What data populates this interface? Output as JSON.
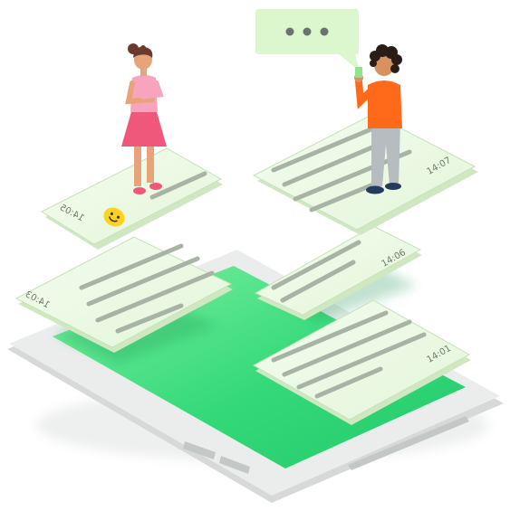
{
  "colors": {
    "background": "#ffffff",
    "device_frame": "#e9ebea",
    "device_edge": "#d6d9d8",
    "screen_green_light": "#7ff0a0",
    "screen_green_dark": "#23c96a",
    "bubble_fill": "#eefae6",
    "bubble_border": "#b9d9a8",
    "bubble_line": "#a7b3a4",
    "speech_bubble": "#dcf6cd",
    "emoji": "#ffd21f",
    "girl_shirt": "#f6a5bd",
    "girl_skirt": "#f0587b",
    "boy_shirt": "#ff6a1a",
    "boy_pants": "#b6bcc0"
  },
  "messages": [
    {
      "id": "msg-1",
      "time": "14:01"
    },
    {
      "id": "msg-2",
      "time": "14:03"
    },
    {
      "id": "msg-3",
      "time": "14:05",
      "emoji": "smiley-icon"
    },
    {
      "id": "msg-4",
      "time": "14:06"
    },
    {
      "id": "msg-5",
      "time": "14:07"
    }
  ],
  "typing_indicator": {
    "icon": "ellipsis-icon"
  },
  "people": [
    {
      "id": "girl",
      "shirt": "pink",
      "skirt": "pink"
    },
    {
      "id": "boy",
      "shirt": "orange",
      "pants": "grey"
    }
  ]
}
